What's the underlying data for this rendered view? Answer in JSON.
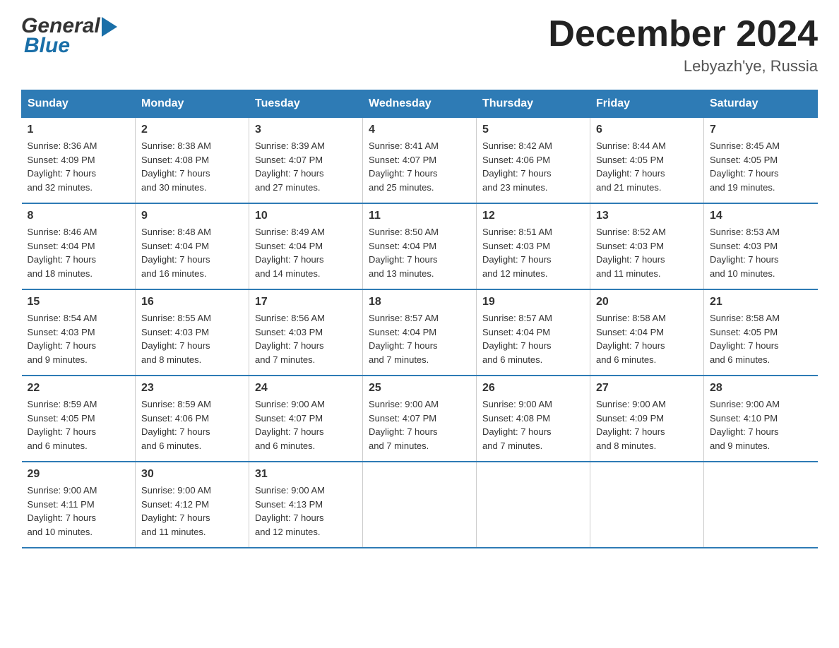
{
  "header": {
    "logo_general": "General",
    "logo_blue": "Blue",
    "month_title": "December 2024",
    "location": "Lebyazh'ye, Russia"
  },
  "days_of_week": [
    "Sunday",
    "Monday",
    "Tuesday",
    "Wednesday",
    "Thursday",
    "Friday",
    "Saturday"
  ],
  "weeks": [
    [
      {
        "day": "1",
        "info": "Sunrise: 8:36 AM\nSunset: 4:09 PM\nDaylight: 7 hours\nand 32 minutes."
      },
      {
        "day": "2",
        "info": "Sunrise: 8:38 AM\nSunset: 4:08 PM\nDaylight: 7 hours\nand 30 minutes."
      },
      {
        "day": "3",
        "info": "Sunrise: 8:39 AM\nSunset: 4:07 PM\nDaylight: 7 hours\nand 27 minutes."
      },
      {
        "day": "4",
        "info": "Sunrise: 8:41 AM\nSunset: 4:07 PM\nDaylight: 7 hours\nand 25 minutes."
      },
      {
        "day": "5",
        "info": "Sunrise: 8:42 AM\nSunset: 4:06 PM\nDaylight: 7 hours\nand 23 minutes."
      },
      {
        "day": "6",
        "info": "Sunrise: 8:44 AM\nSunset: 4:05 PM\nDaylight: 7 hours\nand 21 minutes."
      },
      {
        "day": "7",
        "info": "Sunrise: 8:45 AM\nSunset: 4:05 PM\nDaylight: 7 hours\nand 19 minutes."
      }
    ],
    [
      {
        "day": "8",
        "info": "Sunrise: 8:46 AM\nSunset: 4:04 PM\nDaylight: 7 hours\nand 18 minutes."
      },
      {
        "day": "9",
        "info": "Sunrise: 8:48 AM\nSunset: 4:04 PM\nDaylight: 7 hours\nand 16 minutes."
      },
      {
        "day": "10",
        "info": "Sunrise: 8:49 AM\nSunset: 4:04 PM\nDaylight: 7 hours\nand 14 minutes."
      },
      {
        "day": "11",
        "info": "Sunrise: 8:50 AM\nSunset: 4:04 PM\nDaylight: 7 hours\nand 13 minutes."
      },
      {
        "day": "12",
        "info": "Sunrise: 8:51 AM\nSunset: 4:03 PM\nDaylight: 7 hours\nand 12 minutes."
      },
      {
        "day": "13",
        "info": "Sunrise: 8:52 AM\nSunset: 4:03 PM\nDaylight: 7 hours\nand 11 minutes."
      },
      {
        "day": "14",
        "info": "Sunrise: 8:53 AM\nSunset: 4:03 PM\nDaylight: 7 hours\nand 10 minutes."
      }
    ],
    [
      {
        "day": "15",
        "info": "Sunrise: 8:54 AM\nSunset: 4:03 PM\nDaylight: 7 hours\nand 9 minutes."
      },
      {
        "day": "16",
        "info": "Sunrise: 8:55 AM\nSunset: 4:03 PM\nDaylight: 7 hours\nand 8 minutes."
      },
      {
        "day": "17",
        "info": "Sunrise: 8:56 AM\nSunset: 4:03 PM\nDaylight: 7 hours\nand 7 minutes."
      },
      {
        "day": "18",
        "info": "Sunrise: 8:57 AM\nSunset: 4:04 PM\nDaylight: 7 hours\nand 7 minutes."
      },
      {
        "day": "19",
        "info": "Sunrise: 8:57 AM\nSunset: 4:04 PM\nDaylight: 7 hours\nand 6 minutes."
      },
      {
        "day": "20",
        "info": "Sunrise: 8:58 AM\nSunset: 4:04 PM\nDaylight: 7 hours\nand 6 minutes."
      },
      {
        "day": "21",
        "info": "Sunrise: 8:58 AM\nSunset: 4:05 PM\nDaylight: 7 hours\nand 6 minutes."
      }
    ],
    [
      {
        "day": "22",
        "info": "Sunrise: 8:59 AM\nSunset: 4:05 PM\nDaylight: 7 hours\nand 6 minutes."
      },
      {
        "day": "23",
        "info": "Sunrise: 8:59 AM\nSunset: 4:06 PM\nDaylight: 7 hours\nand 6 minutes."
      },
      {
        "day": "24",
        "info": "Sunrise: 9:00 AM\nSunset: 4:07 PM\nDaylight: 7 hours\nand 6 minutes."
      },
      {
        "day": "25",
        "info": "Sunrise: 9:00 AM\nSunset: 4:07 PM\nDaylight: 7 hours\nand 7 minutes."
      },
      {
        "day": "26",
        "info": "Sunrise: 9:00 AM\nSunset: 4:08 PM\nDaylight: 7 hours\nand 7 minutes."
      },
      {
        "day": "27",
        "info": "Sunrise: 9:00 AM\nSunset: 4:09 PM\nDaylight: 7 hours\nand 8 minutes."
      },
      {
        "day": "28",
        "info": "Sunrise: 9:00 AM\nSunset: 4:10 PM\nDaylight: 7 hours\nand 9 minutes."
      }
    ],
    [
      {
        "day": "29",
        "info": "Sunrise: 9:00 AM\nSunset: 4:11 PM\nDaylight: 7 hours\nand 10 minutes."
      },
      {
        "day": "30",
        "info": "Sunrise: 9:00 AM\nSunset: 4:12 PM\nDaylight: 7 hours\nand 11 minutes."
      },
      {
        "day": "31",
        "info": "Sunrise: 9:00 AM\nSunset: 4:13 PM\nDaylight: 7 hours\nand 12 minutes."
      },
      {
        "day": "",
        "info": ""
      },
      {
        "day": "",
        "info": ""
      },
      {
        "day": "",
        "info": ""
      },
      {
        "day": "",
        "info": ""
      }
    ]
  ]
}
